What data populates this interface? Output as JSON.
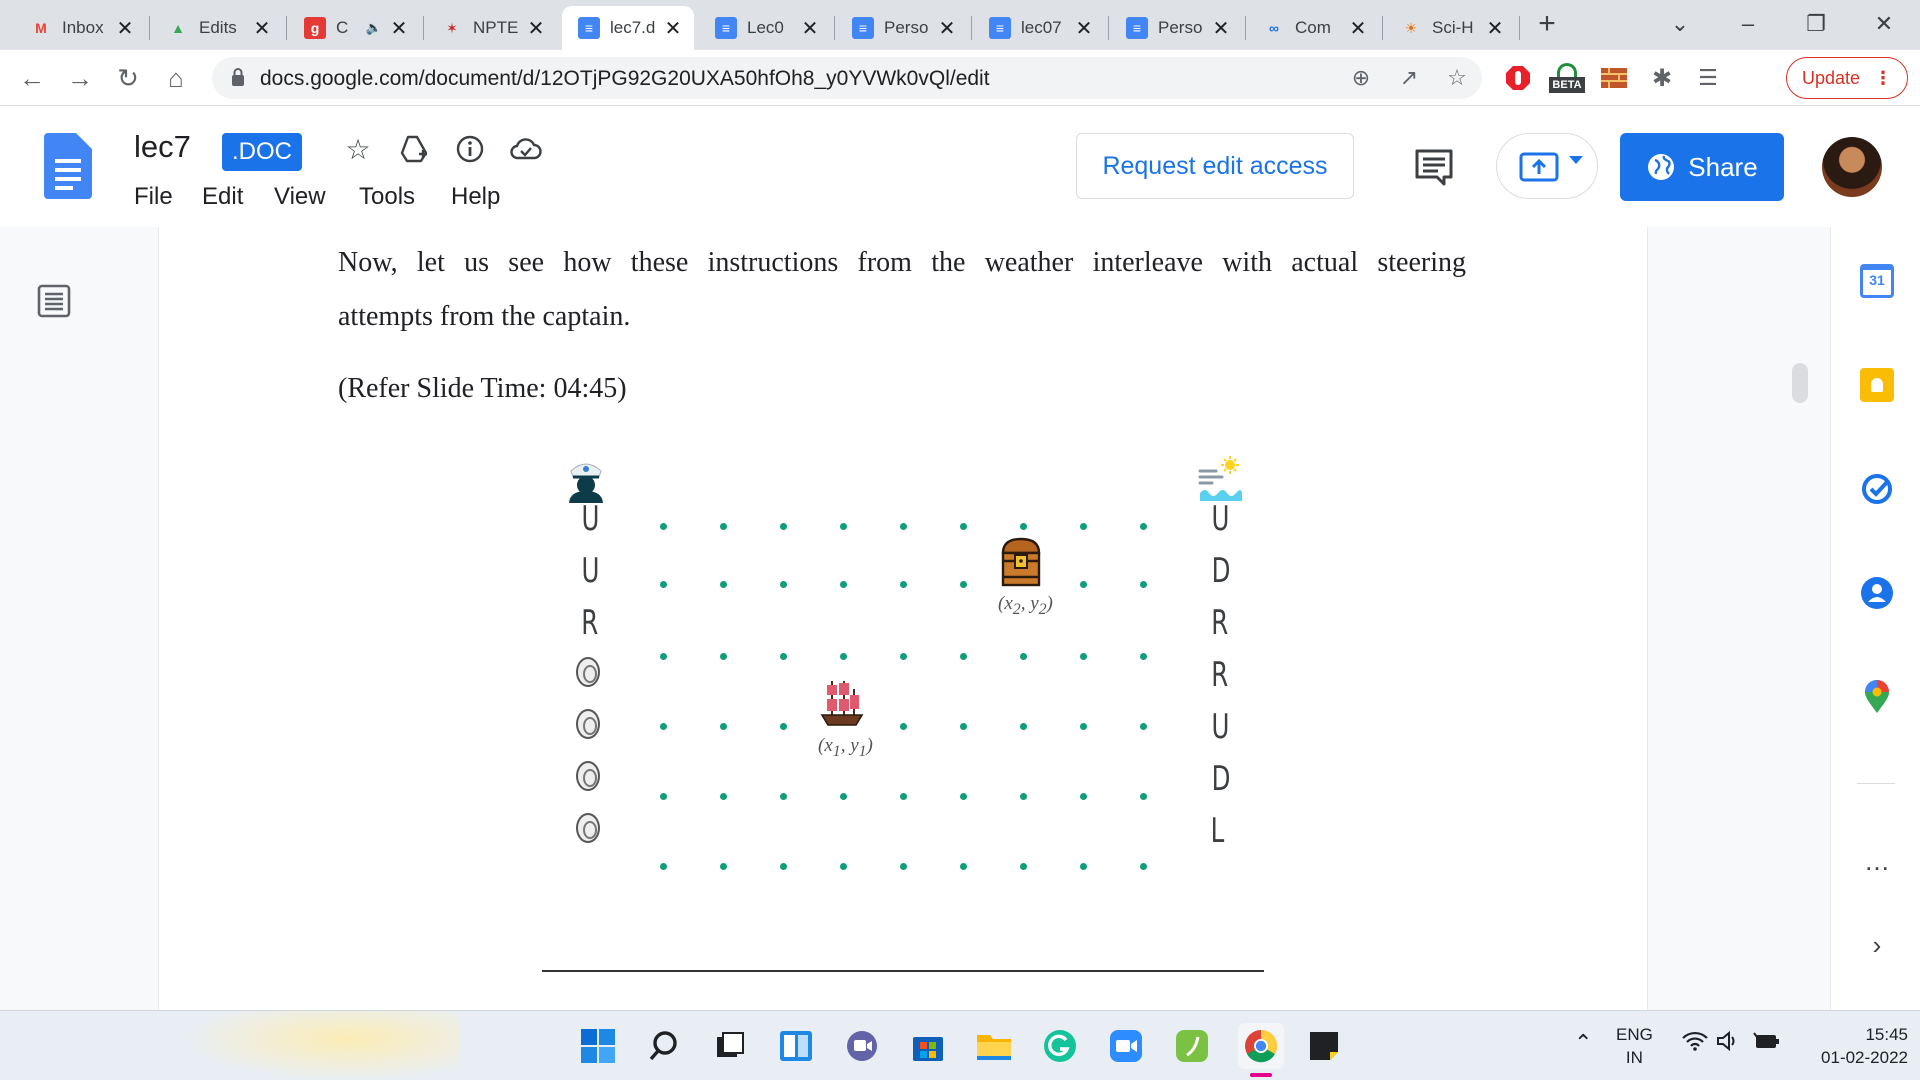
{
  "browser": {
    "tabs": [
      {
        "title": "Inbox",
        "favicon": "gmail-icon",
        "active": false
      },
      {
        "title": "Edits",
        "favicon": "google-drive-icon",
        "active": false
      },
      {
        "title": "C",
        "favicon": "red-g-icon",
        "active": false,
        "audio": true
      },
      {
        "title": "NPTE",
        "favicon": "nptel-icon",
        "active": false
      },
      {
        "title": "lec7.d",
        "favicon": "docs-icon",
        "active": true
      },
      {
        "title": "Lec0",
        "favicon": "docs-icon",
        "active": false
      },
      {
        "title": "Perso",
        "favicon": "docs-icon",
        "active": false
      },
      {
        "title": "lec07",
        "favicon": "docs-icon",
        "active": false
      },
      {
        "title": "Perso",
        "favicon": "docs-icon",
        "active": false
      },
      {
        "title": "Com",
        "favicon": "link-icon",
        "active": false
      },
      {
        "title": "Sci-H",
        "favicon": "sci-hub-icon",
        "active": false
      }
    ],
    "url": "docs.google.com/document/d/12OTjPG92G20UXA50hfOh8_y0YVWk0vQl/edit",
    "update_label": "Update",
    "beta_badge": "BETA"
  },
  "docs": {
    "title": "lec7",
    "extension_badge": ".DOC",
    "menus": [
      "File",
      "Edit",
      "View",
      "Tools",
      "Help"
    ],
    "request_edit_label": "Request edit access",
    "share_label": "Share"
  },
  "document": {
    "paragraph_line1": "Now, let us see how these instructions from the weather interleave with actual steering",
    "paragraph_line2": "attempts from the captain.",
    "slide_ref": "(Refer Slide Time: 04:45)"
  },
  "slide": {
    "captain_sequence": [
      "U",
      "U",
      "R",
      "coin",
      "coin",
      "coin",
      "coin"
    ],
    "weather_sequence": [
      "U",
      "D",
      "R",
      "R",
      "U",
      "D",
      "L"
    ],
    "ship_label_x": "(x",
    "ship_label_sub1": "1",
    "ship_label_y": ", y",
    "ship_label_sub2": "1",
    "ship_label_end": ")",
    "treasure_label_x": "(x",
    "treasure_label_sub1": "2",
    "treasure_label_y": ", y",
    "treasure_label_sub2": "2",
    "treasure_label_end": ")",
    "grid_cols": 9,
    "grid_rows": 6
  },
  "side_panel": {
    "calendar_day": "31",
    "more_label": "…"
  },
  "taskbar": {
    "language_line1": "ENG",
    "language_line2": "IN",
    "time": "15:45",
    "date": "01-02-2022"
  },
  "colors": {
    "accent": "#1a73e8",
    "dots": "#0f9d7a",
    "update": "#d93025"
  }
}
